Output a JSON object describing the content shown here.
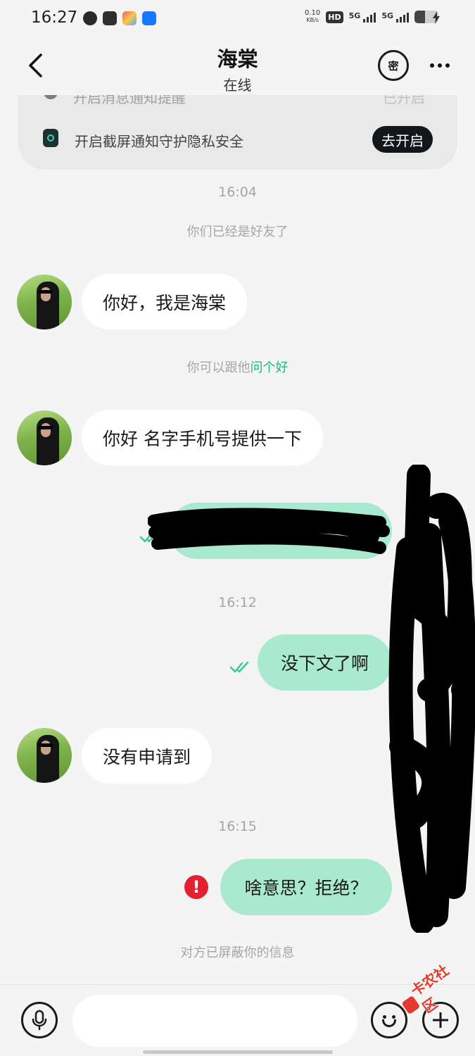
{
  "status_bar": {
    "time": "16:27",
    "net_speed_value": "0.10",
    "net_speed_unit": "KB/s",
    "hd_badge": "HD",
    "signal_1_label": "5G",
    "signal_2_label": "5G",
    "battery_level": 0.45,
    "app_icons": [
      "weibo-icon",
      "mail-icon",
      "camera-app-icon",
      "alipay-icon"
    ]
  },
  "header": {
    "title": "海棠",
    "status": "在线",
    "secret_label": "密"
  },
  "notice": {
    "partial_text": "开启消息通知提醒",
    "partial_status": "已开启",
    "text": "开启截屏通知守护隐私安全",
    "button": "去开启"
  },
  "chat": {
    "timestamp_1": "16:04",
    "system_friends": "你们已经是好友了",
    "msg_1": "你好，我是海棠",
    "hint_prefix": "你可以跟他",
    "hint_link": "问个好",
    "msg_2": "你好 名字手机号提供一下",
    "timestamp_2": "16:12",
    "msg_out_2": "没下文了啊",
    "msg_3": "没有申请到",
    "timestamp_3": "16:15",
    "msg_out_3": "啥意思？拒绝？",
    "system_blocked": "对方已屏蔽你的信息"
  },
  "watermark": "卡农社区",
  "colors": {
    "outgoing_bubble": "#a9e9cf",
    "incoming_bubble": "#ffffff",
    "accent_green": "#19b97d",
    "error_red": "#e5202e",
    "background": "#f4f4f4"
  }
}
